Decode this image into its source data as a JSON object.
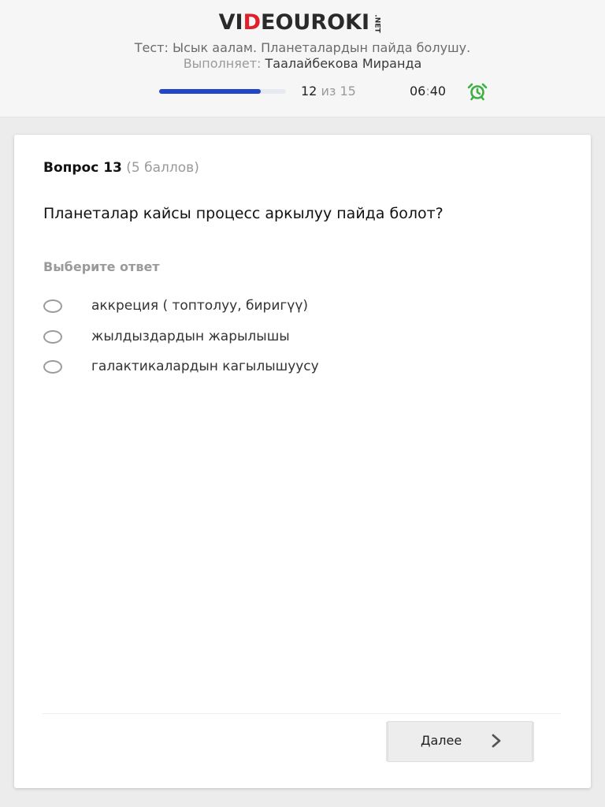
{
  "header": {
    "logo": {
      "part1": "VI",
      "part2": "D",
      "part3": "EOUROKI",
      "suffix": ".NET"
    },
    "test_title": "Тест: Ысык аалам. Планеталардын пайда болушу.",
    "performer_label": "Выполняет:",
    "performer_name": "Таалайбекова Миранда",
    "progress": {
      "current": "12",
      "of_label": "из",
      "total": "15",
      "fraction": 0.8
    },
    "timer": {
      "minutes": "06",
      "separator": ":",
      "seconds": "40"
    },
    "alarm_icon": "alarm-clock-icon",
    "accent_color": "#2345c8",
    "alarm_color": "#3cb043",
    "logo_red": "#e0202a"
  },
  "question": {
    "number_label": "Вопрос 13",
    "points_label": "(5 баллов)",
    "text": "Планеталар кайсы процесс аркылуу пайда болот?",
    "choose_label": "Выберите ответ",
    "options": [
      {
        "label": "аккреция ( топтолуу, биригүү)"
      },
      {
        "label": "жылдыздардын жарылышы"
      },
      {
        "label": "галактикалардын кагылышуусу"
      }
    ]
  },
  "footer": {
    "next_label": "Далее",
    "next_icon": "chevron-right-icon"
  }
}
